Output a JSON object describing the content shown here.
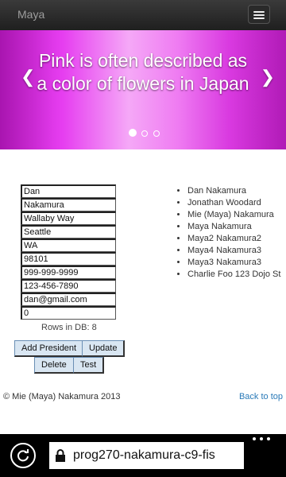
{
  "navbar": {
    "brand": "Maya"
  },
  "carousel": {
    "caption": "Pink is often described as a color of flowers in Japan",
    "slide_count": 3,
    "active_slide": 1
  },
  "form": {
    "fields": [
      {
        "value": "Dan"
      },
      {
        "value": "Nakamura"
      },
      {
        "value": "Wallaby Way"
      },
      {
        "value": "Seattle"
      },
      {
        "value": "WA"
      },
      {
        "value": "98101"
      },
      {
        "value": "999-999-9999"
      },
      {
        "value": "123-456-7890"
      },
      {
        "value": "dan@gmail.com"
      },
      {
        "value": "0"
      }
    ],
    "rows_label": "Rows in DB: 8",
    "buttons": {
      "add": "Add President",
      "update": "Update",
      "delete": "Delete",
      "test": "Test"
    }
  },
  "presidents": [
    "Dan Nakamura",
    "Jonathan Woodard",
    "Mie (Maya) Nakamura",
    "Maya Nakamura",
    "Maya2 Nakamura2",
    "Maya4 Nakamura3",
    "Maya3 Nakamura3",
    "Charlie Foo 123 Dojo St"
  ],
  "footer": {
    "copyright": "© Mie (Maya) Nakamura 2013",
    "back_to_top": "Back to top"
  },
  "browser": {
    "url": "prog270-nakamura-c9-fis"
  },
  "colors": {
    "accent_link": "#2a7ab8",
    "carousel_pink": "#e63ef0",
    "navbar": "#2b2b2b"
  }
}
